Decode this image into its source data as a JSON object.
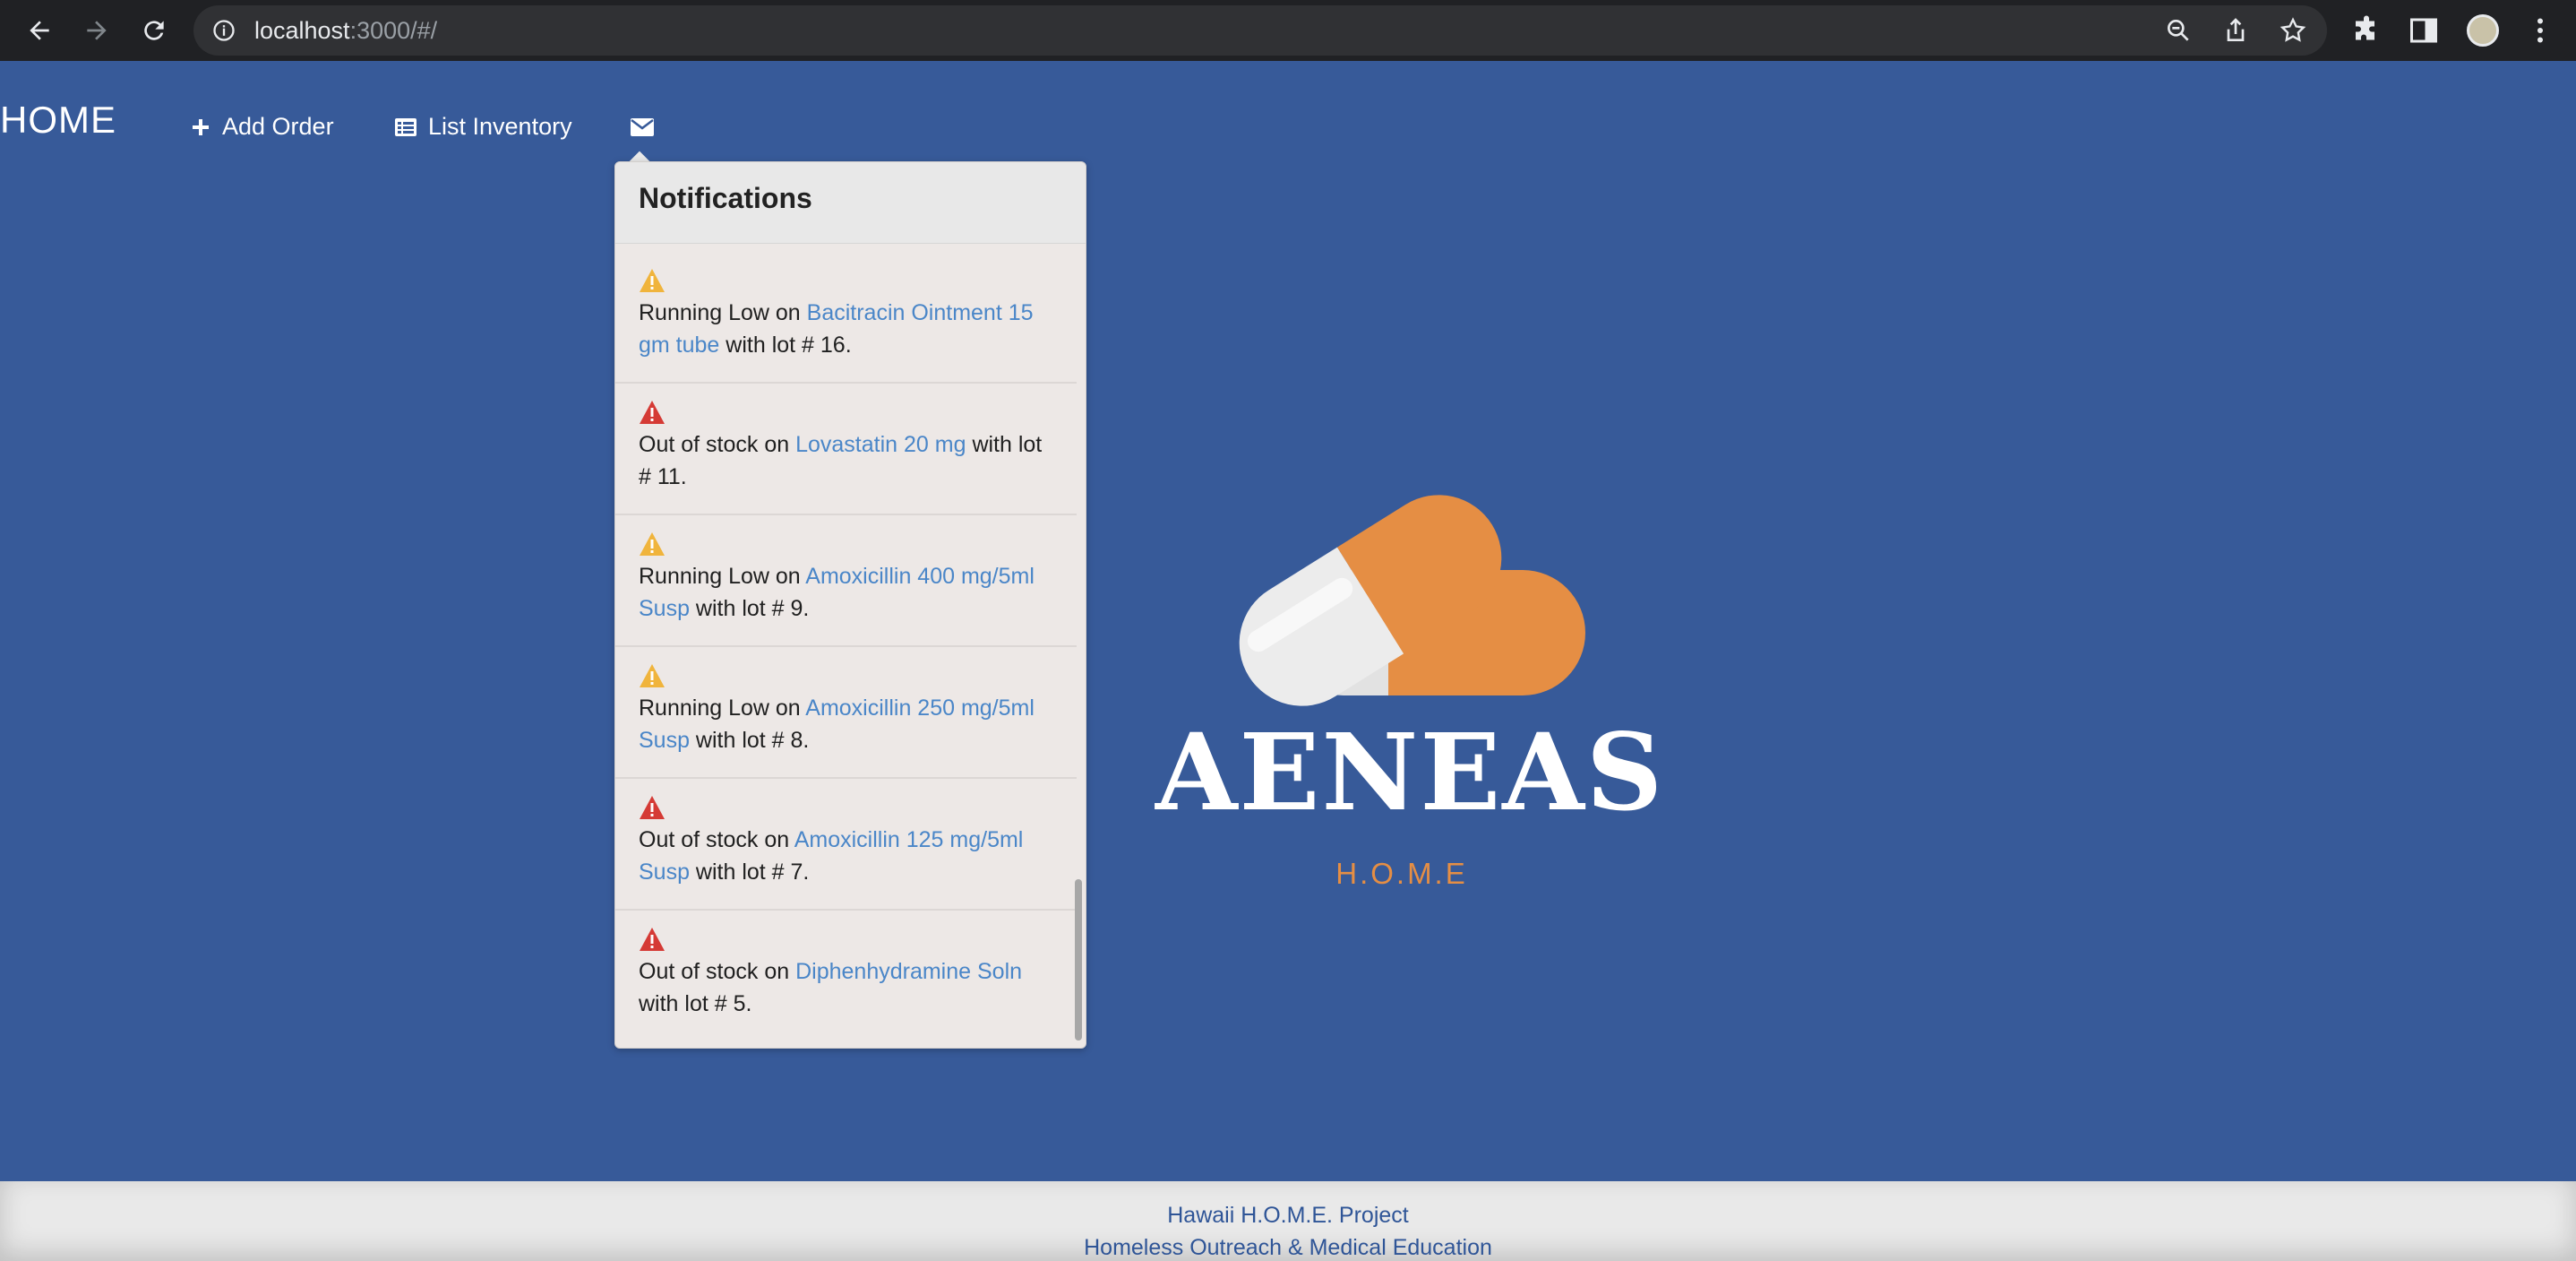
{
  "browser": {
    "url_host": "localhost",
    "url_rest": ":3000/#/",
    "icons": [
      "back-icon",
      "forward-icon",
      "reload-icon",
      "info-icon",
      "zoom-icon",
      "share-icon",
      "star-icon",
      "extensions-icon",
      "sidepanel-icon",
      "profile-avatar",
      "menu-icon"
    ]
  },
  "navbar": {
    "brand": "HOME",
    "add_order": "Add Order",
    "list_inventory": "List Inventory",
    "mail_icon": "envelope-icon"
  },
  "notifications": {
    "title": "Notifications",
    "items": [
      {
        "level": "warning",
        "prefix": "Running Low on ",
        "link": "Bacitracin Ointment 15 gm tube",
        "suffix": " with lot # 16."
      },
      {
        "level": "danger",
        "prefix": "Out of stock on ",
        "link": "Lovastatin 20 mg",
        "suffix": " with lot # 11."
      },
      {
        "level": "warning",
        "prefix": "Running Low on ",
        "link": "Amoxicillin 400 mg/5ml Susp",
        "suffix": " with lot # 9."
      },
      {
        "level": "warning",
        "prefix": "Running Low on ",
        "link": "Amoxicillin 250 mg/5ml Susp",
        "suffix": " with lot # 8."
      },
      {
        "level": "danger",
        "prefix": "Out of stock on ",
        "link": "Amoxicillin 125 mg/5ml Susp",
        "suffix": " with lot # 7."
      },
      {
        "level": "danger",
        "prefix": "Out of stock on ",
        "link": "Diphenhydramine Soln",
        "suffix": " with lot # 5."
      }
    ]
  },
  "logo": {
    "title": "AENEAS",
    "subtitle": "H.O.M.E"
  },
  "footer": {
    "line1": "Hawaii H.O.M.E. Project",
    "line2": "Homeless Outreach & Medical Education"
  },
  "colors": {
    "background": "#375a99",
    "warning": "#f0b43c",
    "danger": "#d53a35",
    "link": "#4a86c8",
    "accent": "#e58e44"
  }
}
